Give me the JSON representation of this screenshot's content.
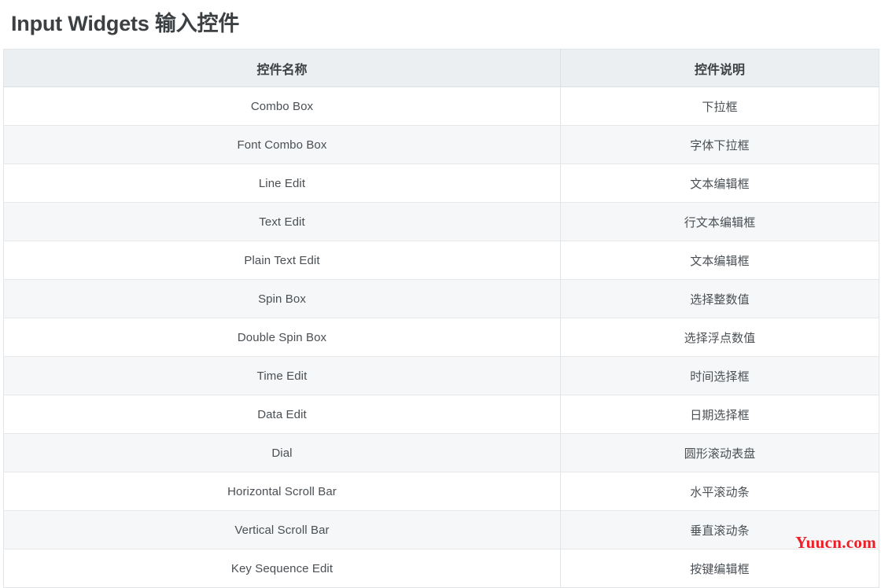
{
  "page": {
    "title": "Input Widgets 输入控件"
  },
  "table": {
    "headers": [
      "控件名称",
      "控件说明"
    ],
    "rows": [
      {
        "name": "Combo Box",
        "desc": "下拉框"
      },
      {
        "name": "Font Combo Box",
        "desc": "字体下拉框"
      },
      {
        "name": "Line Edit",
        "desc": "文本编辑框"
      },
      {
        "name": "Text Edit",
        "desc": "行文本编辑框"
      },
      {
        "name": "Plain Text Edit",
        "desc": "文本编辑框"
      },
      {
        "name": "Spin Box",
        "desc": "选择整数值"
      },
      {
        "name": "Double Spin Box",
        "desc": "选择浮点数值"
      },
      {
        "name": "Time Edit",
        "desc": "时间选择框"
      },
      {
        "name": "Data Edit",
        "desc": "日期选择框"
      },
      {
        "name": "Dial",
        "desc": "圆形滚动表盘"
      },
      {
        "name": "Horizontal Scroll Bar",
        "desc": "水平滚动条"
      },
      {
        "name": "Vertical Scroll Bar",
        "desc": "垂直滚动条"
      },
      {
        "name": "Key Sequence Edit",
        "desc": "按键编辑框"
      }
    ]
  },
  "watermark": {
    "text": "Yuucn.com",
    "color": "#ee1c25"
  },
  "colors": {
    "header_bg": "#eceff1",
    "row_alt_bg": "#f6f7f8",
    "row_bg": "#ffffff",
    "border": "#e2e5e8",
    "title_text": "#3c4043",
    "body_text": "#4a4f54"
  }
}
